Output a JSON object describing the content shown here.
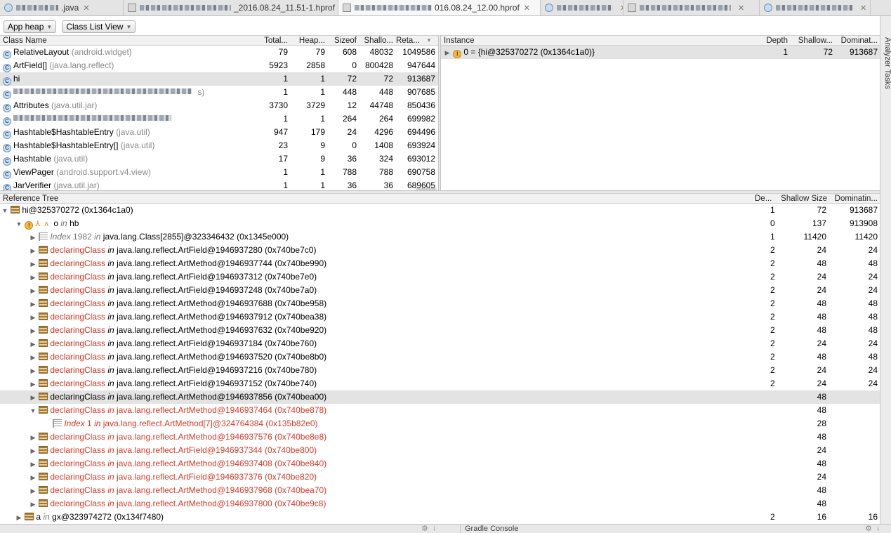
{
  "tabs": [
    {
      "label": ".java",
      "icon": "class-file-icon",
      "active": false
    },
    {
      "label": "_2016.08.24_11.51-1.hprof",
      "icon": "hprof-file-icon",
      "active": false
    },
    {
      "label": "016.08.24_12.00.hprof",
      "icon": "hprof-file-icon",
      "active": true
    },
    {
      "label": "",
      "icon": "class-file-icon",
      "active": false
    },
    {
      "label": "",
      "icon": "hprof-file-icon",
      "active": false
    },
    {
      "label": "",
      "icon": "class-file-icon",
      "active": false
    }
  ],
  "toolbar": {
    "heap_select": "App heap",
    "view_select": "Class List View"
  },
  "class_list": {
    "headers": {
      "name": "Class Name",
      "total": "Total...",
      "heap": "Heap...",
      "sizeof": "Sizeof",
      "shallow": "Shallo...",
      "retained": "Reta..."
    },
    "rows": [
      {
        "name": "RelativeLayout",
        "pkg": "(android.widget)",
        "total": "79",
        "heap": "79",
        "sizeof": "608",
        "shallow": "48032",
        "retained": "1049586"
      },
      {
        "name": "ArtField[]",
        "pkg": "(java.lang.reflect)",
        "total": "5923",
        "heap": "2858",
        "sizeof": "0",
        "shallow": "800428",
        "retained": "947644"
      },
      {
        "name": "hi",
        "pkg": "",
        "total": "1",
        "heap": "1",
        "sizeof": "72",
        "shallow": "72",
        "retained": "913687",
        "selected": true
      },
      {
        "name": "",
        "pkg": "s)",
        "total": "1",
        "heap": "1",
        "sizeof": "448",
        "shallow": "448",
        "retained": "907685",
        "blurred": true
      },
      {
        "name": "Attributes",
        "pkg": "(java.util.jar)",
        "total": "3730",
        "heap": "3729",
        "sizeof": "12",
        "shallow": "44748",
        "retained": "850436"
      },
      {
        "name": "",
        "pkg": "",
        "total": "1",
        "heap": "1",
        "sizeof": "264",
        "shallow": "264",
        "retained": "699982",
        "blurred": true
      },
      {
        "name": "Hashtable$HashtableEntry",
        "pkg": "(java.util)",
        "total": "947",
        "heap": "179",
        "sizeof": "24",
        "shallow": "4296",
        "retained": "694496"
      },
      {
        "name": "Hashtable$HashtableEntry[]",
        "pkg": "(java.util)",
        "total": "23",
        "heap": "9",
        "sizeof": "0",
        "shallow": "1408",
        "retained": "693924"
      },
      {
        "name": "Hashtable",
        "pkg": "(java.util)",
        "total": "17",
        "heap": "9",
        "sizeof": "36",
        "shallow": "324",
        "retained": "693012"
      },
      {
        "name": "ViewPager",
        "pkg": "(android.support.v4.view)",
        "total": "1",
        "heap": "1",
        "sizeof": "788",
        "shallow": "788",
        "retained": "690758"
      },
      {
        "name": "JarVerifier",
        "pkg": "(java.util.jar)",
        "total": "1",
        "heap": "1",
        "sizeof": "36",
        "shallow": "36",
        "retained": "689605"
      }
    ]
  },
  "instance_list": {
    "headers": {
      "instance": "Instance",
      "depth": "Depth",
      "shallow": "Shallow...",
      "dominating": "Dominat..."
    },
    "rows": [
      {
        "label": "0 = {hi@325370272 (0x1364c1a0)}",
        "depth": "1",
        "shallow": "72",
        "dominating": "913687"
      }
    ]
  },
  "reference_tree": {
    "headers": {
      "tree": "Reference Tree",
      "depth": "De...",
      "shallow": "Shallow Size",
      "dominating": "Dominatin..."
    },
    "root": {
      "label": "hi@325370272 (0x1364c1a0)",
      "depth": "1",
      "shallow": "72",
      "dominating": "913687"
    },
    "child": {
      "field": "o",
      "in_word": "in",
      "owner": "hb",
      "depth": "0",
      "shallow": "137",
      "dominating": "913908"
    },
    "index_row": {
      "index_word": "Index",
      "index": "1982",
      "in_word": "in",
      "owner": "java.lang.Class[2855]@323346432 (0x1345e000)",
      "depth": "1",
      "shallow": "11420",
      "dominating": "11420"
    },
    "black_rows": [
      {
        "field": "declaringClass",
        "owner": "java.lang.reflect.ArtField@1946937280 (0x740be7c0)",
        "depth": "2",
        "shallow": "24",
        "dominating": "24"
      },
      {
        "field": "declaringClass",
        "owner": "java.lang.reflect.ArtMethod@1946937744 (0x740be990)",
        "depth": "2",
        "shallow": "48",
        "dominating": "48"
      },
      {
        "field": "declaringClass",
        "owner": "java.lang.reflect.ArtField@1946937312 (0x740be7e0)",
        "depth": "2",
        "shallow": "24",
        "dominating": "24"
      },
      {
        "field": "declaringClass",
        "owner": "java.lang.reflect.ArtField@1946937248 (0x740be7a0)",
        "depth": "2",
        "shallow": "24",
        "dominating": "24"
      },
      {
        "field": "declaringClass",
        "owner": "java.lang.reflect.ArtMethod@1946937688 (0x740be958)",
        "depth": "2",
        "shallow": "48",
        "dominating": "48"
      },
      {
        "field": "declaringClass",
        "owner": "java.lang.reflect.ArtMethod@1946937912 (0x740bea38)",
        "depth": "2",
        "shallow": "48",
        "dominating": "48"
      },
      {
        "field": "declaringClass",
        "owner": "java.lang.reflect.ArtMethod@1946937632 (0x740be920)",
        "depth": "2",
        "shallow": "48",
        "dominating": "48"
      },
      {
        "field": "declaringClass",
        "owner": "java.lang.reflect.ArtField@1946937184 (0x740be760)",
        "depth": "2",
        "shallow": "24",
        "dominating": "24"
      },
      {
        "field": "declaringClass",
        "owner": "java.lang.reflect.ArtMethod@1946937520 (0x740be8b0)",
        "depth": "2",
        "shallow": "48",
        "dominating": "48"
      },
      {
        "field": "declaringClass",
        "owner": "java.lang.reflect.ArtField@1946937216 (0x740be780)",
        "depth": "2",
        "shallow": "24",
        "dominating": "24"
      },
      {
        "field": "declaringClass",
        "owner": "java.lang.reflect.ArtField@1946937152 (0x740be740)",
        "depth": "2",
        "shallow": "24",
        "dominating": "24"
      },
      {
        "field": "declaringClass",
        "owner": "java.lang.reflect.ArtMethod@1946937856 (0x740bea00)",
        "depth": "",
        "shallow": "48",
        "dominating": "",
        "selected": true
      }
    ],
    "expanded_red": {
      "field": "declaringClass",
      "owner": "java.lang.reflect.ArtMethod@1946937464 (0x740be878)",
      "shallow": "48"
    },
    "red_index_row": {
      "index_word": "Index",
      "index": "1",
      "in_word": "in",
      "owner": "java.lang.reflect.ArtMethod[7]@324764384 (0x135b82e0)",
      "shallow": "28"
    },
    "red_rows": [
      {
        "field": "declaringClass",
        "owner": "java.lang.reflect.ArtMethod@1946937576 (0x740be8e8)",
        "shallow": "48"
      },
      {
        "field": "declaringClass",
        "owner": "java.lang.reflect.ArtField@1946937344 (0x740be800)",
        "shallow": "24"
      },
      {
        "field": "declaringClass",
        "owner": "java.lang.reflect.ArtMethod@1946937408 (0x740be840)",
        "shallow": "48"
      },
      {
        "field": "declaringClass",
        "owner": "java.lang.reflect.ArtField@1946937376 (0x740be820)",
        "shallow": "24"
      },
      {
        "field": "declaringClass",
        "owner": "java.lang.reflect.ArtMethod@1946937968 (0x740bea70)",
        "shallow": "48"
      },
      {
        "field": "declaringClass",
        "owner": "java.lang.reflect.ArtMethod@1946937800 (0x740be9c8)",
        "shallow": "48"
      }
    ],
    "last_row": {
      "field": "a",
      "in_word": "in",
      "owner": "gx@323974272 (0x134f7480)",
      "depth": "2",
      "shallow": "16",
      "dominating": "16"
    },
    "in_word": "in"
  },
  "right_rail": {
    "label": "Analyzer Tasks"
  },
  "bottom": {
    "gradle_console": "Gradle Console"
  },
  "colors": {
    "red_text": "#d93a2b",
    "selection": "#e3e3e3",
    "header_bg": "#f1f1f1"
  }
}
